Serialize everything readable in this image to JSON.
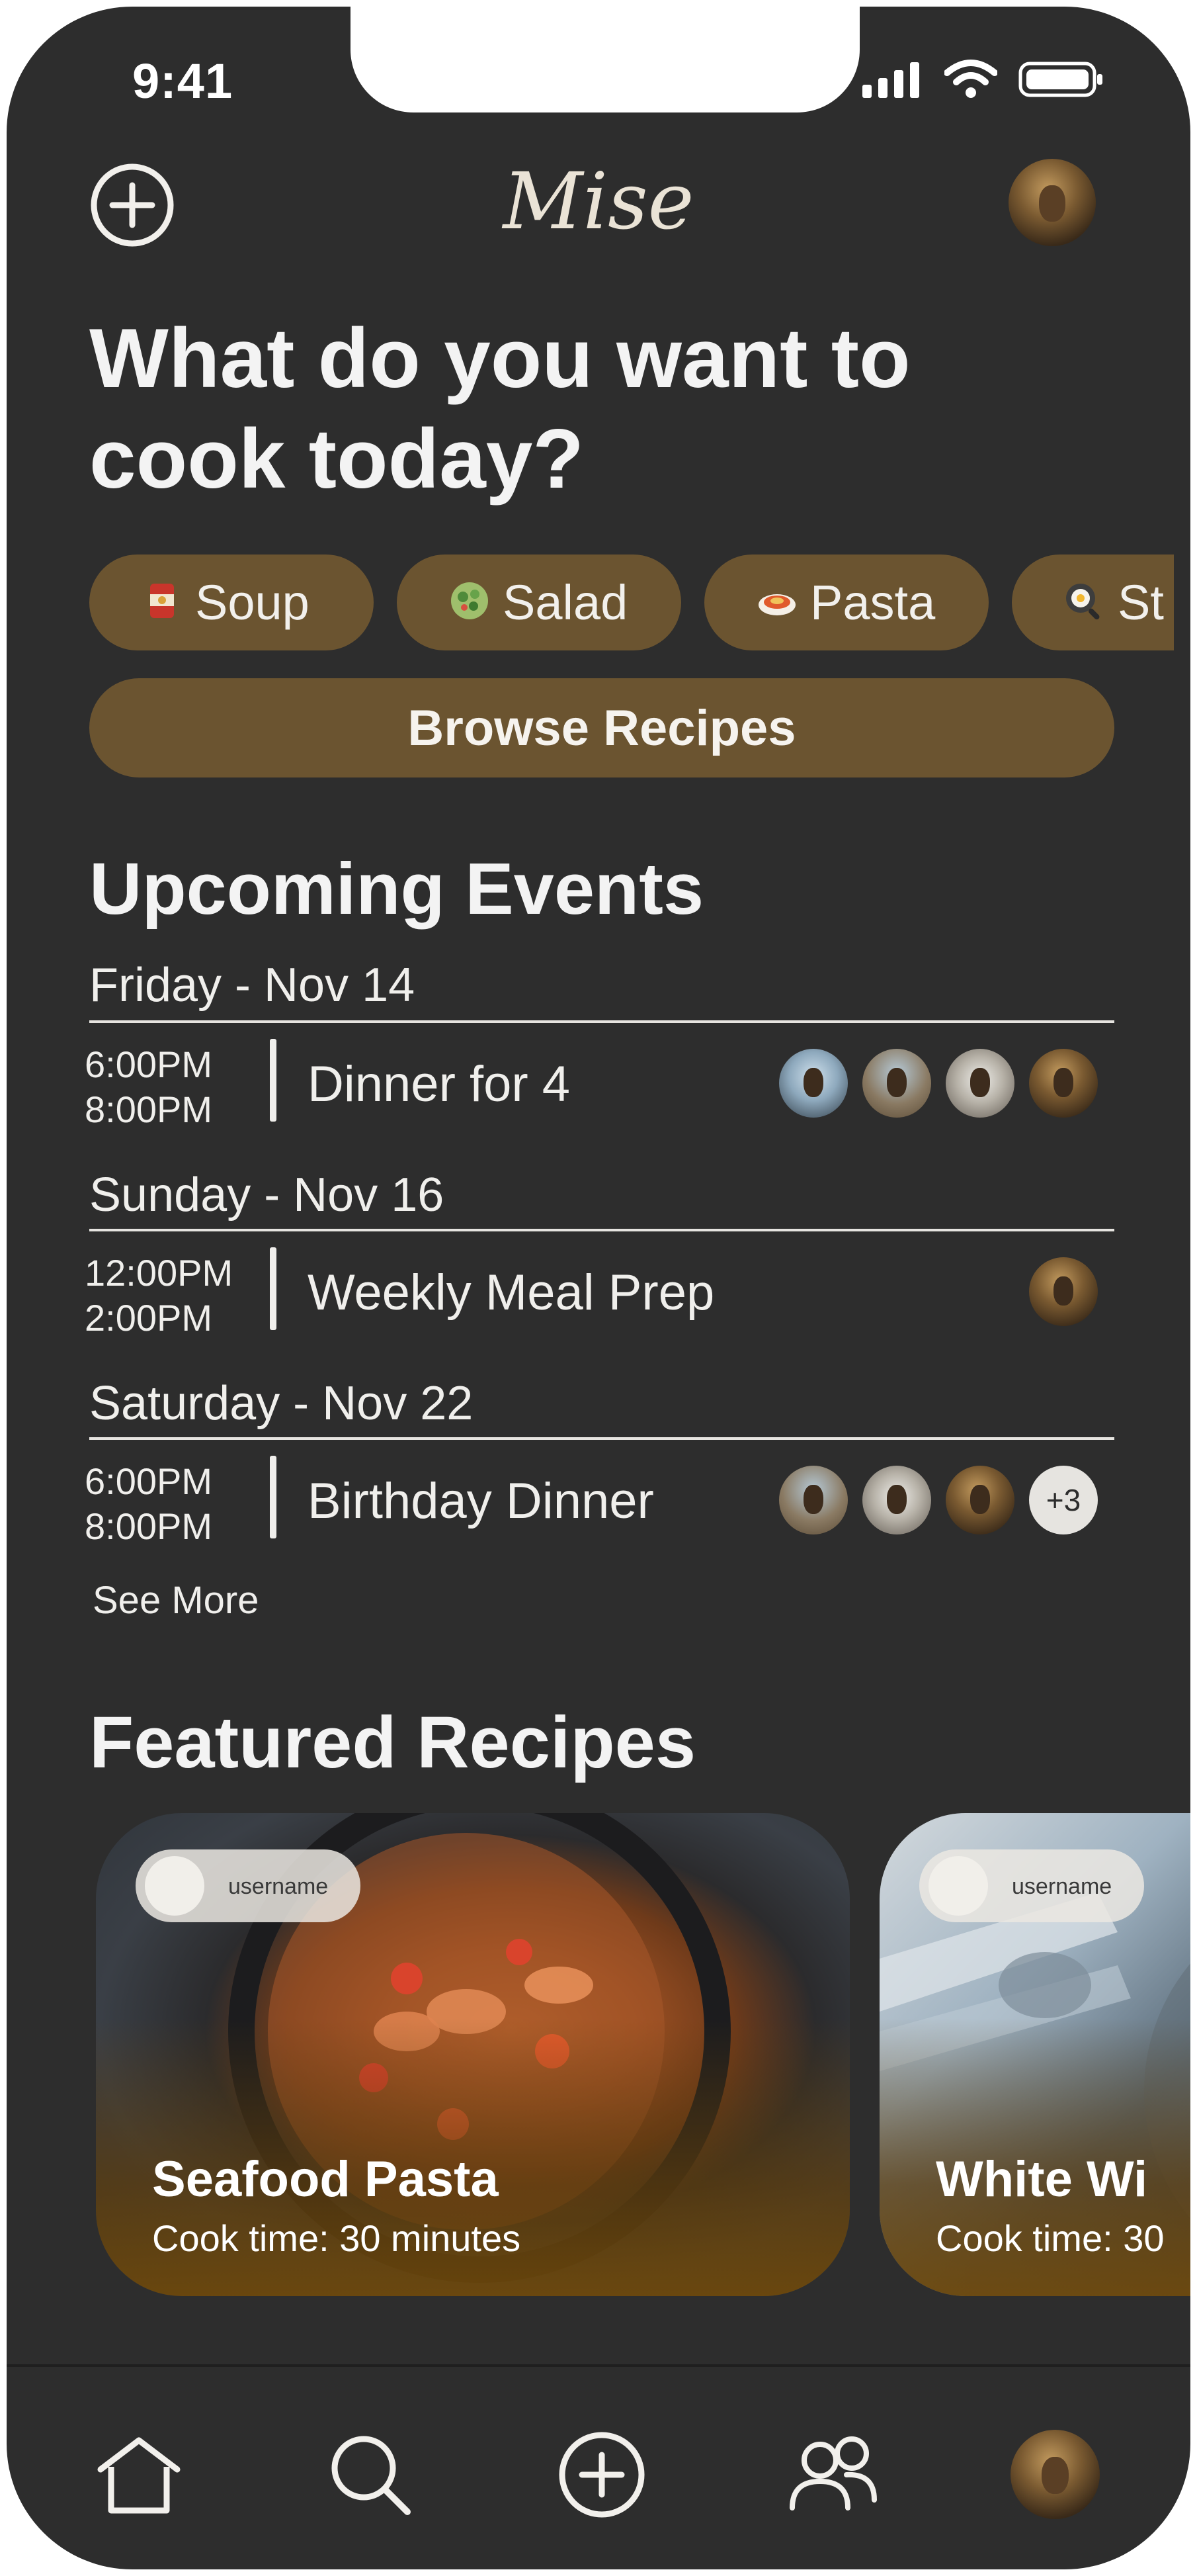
{
  "status_bar": {
    "time": "9:41"
  },
  "header": {
    "app_title": "Mise",
    "add_icon": "plus-circle-icon",
    "avatar": "profile-avatar"
  },
  "hero": {
    "headline": "What do you want to cook today?"
  },
  "categories": [
    {
      "label": "Soup",
      "icon": "soup-can-icon"
    },
    {
      "label": "Salad",
      "icon": "salad-bowl-icon"
    },
    {
      "label": "Pasta",
      "icon": "spaghetti-icon"
    },
    {
      "label": "St",
      "icon": "frying-pan-icon"
    }
  ],
  "browse_button": {
    "label": "Browse Recipes"
  },
  "upcoming": {
    "title": "Upcoming Events",
    "days": [
      {
        "date": "Friday - Nov 14",
        "event": {
          "start": "6:00PM",
          "end": "8:00PM",
          "name": "Dinner for 4",
          "attendees": 4,
          "extra": ""
        }
      },
      {
        "date": "Sunday - Nov 16",
        "event": {
          "start": "12:00PM",
          "end": "2:00PM",
          "name": "Weekly Meal Prep",
          "attendees": 1,
          "extra": ""
        }
      },
      {
        "date": "Saturday - Nov 22",
        "event": {
          "start": "6:00PM",
          "end": "8:00PM",
          "name": "Birthday Dinner",
          "attendees": 3,
          "extra": "+3"
        }
      }
    ],
    "see_more": "See More"
  },
  "featured": {
    "title": "Featured Recipes",
    "recipes": [
      {
        "username": "username",
        "title": "Seafood Pasta",
        "subtitle": "Cook time: 30 minutes"
      },
      {
        "username": "username",
        "title": "White Wi",
        "subtitle": "Cook time: 30"
      }
    ]
  },
  "tab_bar": {
    "items": [
      "home-icon",
      "search-icon",
      "create-plus-icon",
      "friends-icon",
      "profile-avatar"
    ]
  },
  "colors": {
    "background": "#2d2d2d",
    "accent": "#6b5430",
    "text": "#f2f0ec"
  }
}
